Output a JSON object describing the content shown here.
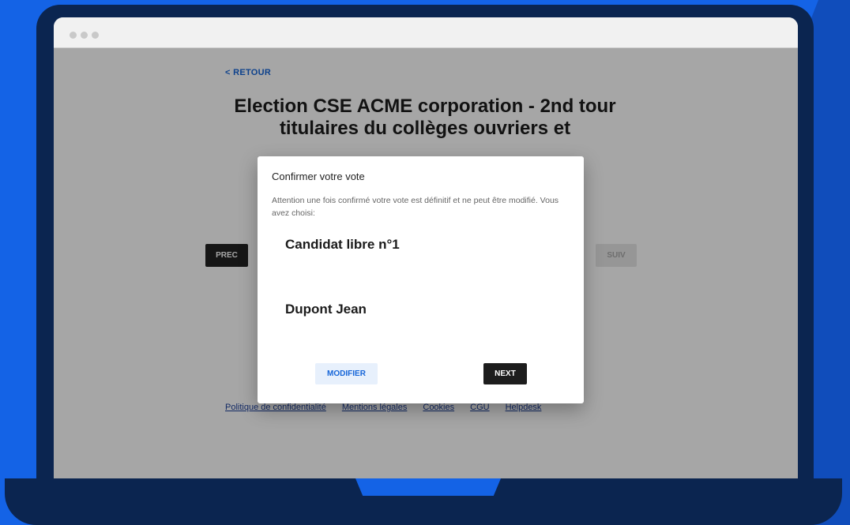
{
  "browser": {
    "dots": [
      "",
      "",
      ""
    ]
  },
  "page": {
    "back_link": "< RETOUR",
    "title_line1": "Election CSE ACME corporation - 2nd tour",
    "title_line2": "titulaires du collèges ouvriers et",
    "prev_button": "PREC",
    "next_button": "SUIV"
  },
  "footer": {
    "links": [
      "Politique de confidentialité",
      "Mentions légales",
      "Cookies",
      "CGU",
      "Helpdesk"
    ]
  },
  "dialog": {
    "title": "Confirmer votre vote",
    "text": "Attention une fois confirmé votre vote est définitif et ne peut être modifié. Vous avez choisi:",
    "choices": [
      "Candidat libre n°1",
      "Dupont Jean"
    ],
    "modify_label": "MODIFIER",
    "next_label": "NEXT"
  },
  "colors": {
    "background": "#1463e6",
    "laptop": "#0b2550",
    "accent": "#1565d8"
  }
}
